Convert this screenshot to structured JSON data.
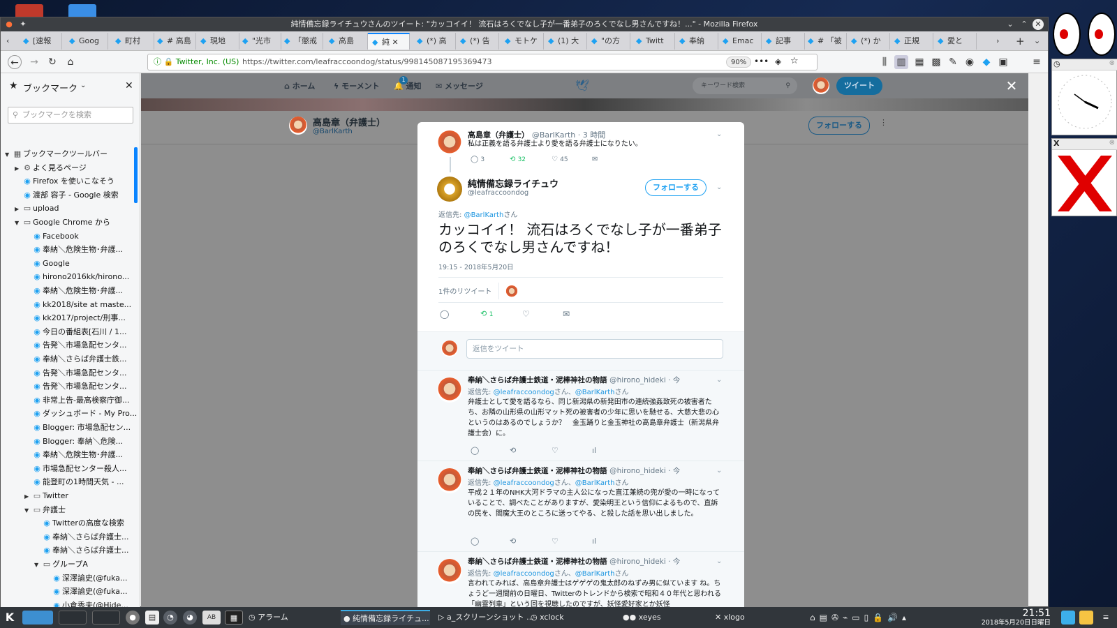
{
  "window": {
    "title": "純情備忘録ライチュウさんのツイート: \"カッコイイ！ 流石はろくでなし子が一番弟子のろくでなし男さんですね！...\" - Mozilla Firefox"
  },
  "tabs": [
    {
      "label": "[速報"
    },
    {
      "label": "Goog"
    },
    {
      "label": "町村"
    },
    {
      "label": "# 高島"
    },
    {
      "label": "現地"
    },
    {
      "label": "\"光市"
    },
    {
      "label": "「懲戒"
    },
    {
      "label": "高島"
    },
    {
      "label": "純"
    },
    {
      "label": "(*) 高"
    },
    {
      "label": "(*) 告"
    },
    {
      "label": "モトケ"
    },
    {
      "label": "(1) 大"
    },
    {
      "label": "\"の方"
    },
    {
      "label": "Twitt"
    },
    {
      "label": "奉納"
    },
    {
      "label": "Emac"
    },
    {
      "label": "記事"
    },
    {
      "label": "# 「被"
    },
    {
      "label": "(*) か"
    },
    {
      "label": "正規"
    },
    {
      "label": "愛と"
    }
  ],
  "urlbar": {
    "site": "Twitter, Inc. (US)",
    "url": "https://twitter.com/leafraccoondog/status/998145087195369473",
    "zoom": "90%"
  },
  "sidebar": {
    "title": "ブックマーク",
    "search_placeholder": "ブックマークを検索",
    "items": [
      {
        "label": "ブックマークツールバー"
      },
      {
        "label": "よく見るページ"
      },
      {
        "label": "Firefox を使いこなそう"
      },
      {
        "label": "渡部 容子 - Google 検索"
      },
      {
        "label": "upload"
      },
      {
        "label": "Google Chrome から"
      },
      {
        "label": "Facebook"
      },
      {
        "label": "奉納＼危険生物･弁護..."
      },
      {
        "label": "Google"
      },
      {
        "label": "hirono2016kk/hirono..."
      },
      {
        "label": "奉納＼危険生物･弁護..."
      },
      {
        "label": "kk2018/site at maste..."
      },
      {
        "label": "kk2017/project/刑事..."
      },
      {
        "label": "今日の番組表[石川 / 1..."
      },
      {
        "label": "告発＼市場急配センタ..."
      },
      {
        "label": "奉納＼さらば弁護士鉄..."
      },
      {
        "label": "告発＼市場急配センタ..."
      },
      {
        "label": "告発＼市場急配センタ..."
      },
      {
        "label": "非常上告-最高検察庁御..."
      },
      {
        "label": "ダッシュボード - My Pro..."
      },
      {
        "label": "Blogger: 市場急配セン..."
      },
      {
        "label": "Blogger: 奉納＼危険..."
      },
      {
        "label": "奉納＼危険生物･弁護..."
      },
      {
        "label": "市場急配センター殺人..."
      },
      {
        "label": "能登町の1時間天気 - ..."
      },
      {
        "label": "Twitter"
      },
      {
        "label": "弁護士"
      },
      {
        "label": "Twitterの高度な検索"
      },
      {
        "label": "奉納＼さらば弁護士..."
      },
      {
        "label": "奉納＼さらば弁護士..."
      },
      {
        "label": "グループA"
      },
      {
        "label": "深澤諭史(@fuka..."
      },
      {
        "label": "深澤諭史(@fuka..."
      },
      {
        "label": "小倉秀夫(@Hide..."
      }
    ]
  },
  "twitter_nav": {
    "home": "ホーム",
    "moments": "モーメント",
    "notifications": "通知",
    "notif_count": "1",
    "messages": "メッセージ",
    "search_placeholder": "キーワード検索",
    "tweet_button": "ツイート"
  },
  "profile_header": {
    "name": "高島章（弁護士）",
    "handle": "@BarlKarth",
    "follow": "フォローする"
  },
  "parent_tweet": {
    "name": "高島章（弁護士）",
    "handle": "@BarlKarth · 3 時間",
    "text": "私は正義を語る弁護士より愛を語る弁護士になりたい。",
    "replies": "3",
    "retweets": "32",
    "likes": "45"
  },
  "main_tweet": {
    "name": "純情備忘録ライチュウ",
    "handle": "@leafraccoondog",
    "follow": "フォローする",
    "reply_to_prefix": "返信先: ",
    "reply_to_user": "@BarlKarth",
    "reply_to_suffix": "さん",
    "text": "カッコイイ！ 流石はろくでなし子が一番弟子のろくでなし男さんですね！",
    "timestamp": "19:15 - 2018年5月20日",
    "retweet_count_label": "1件のリツイート",
    "retweet_count_num": "1",
    "action_retweets": "1"
  },
  "reply_box": {
    "placeholder": "返信をツイート"
  },
  "replies": [
    {
      "name": "奉納＼さらば弁護士鉄道・泥棒神社の物語",
      "handle": "@hirono_hideki · 今",
      "to1": "@leafraccoondog",
      "mid": "さん、",
      "to2": "@BarlKarth",
      "end": "さん",
      "text": "弁護士として愛を語るなら、同じ新潟県の新発田市の連続強姦致死の被害者たち、お隣の山形県の山形マット死の被害者の少年に思いを馳せる、大慈大悲の心というのはあるのでしょうか？　金玉踊りと金玉神社の高島章弁護士（新潟県弁護士会）に。"
    },
    {
      "name": "奉納＼さらば弁護士鉄道・泥棒神社の物語",
      "handle": "@hirono_hideki · 今",
      "to1": "@leafraccoondog",
      "mid": "さん、",
      "to2": "@BarlKarth",
      "end": "さん",
      "text": "平成２１年のNHK大河ドラマの主人公になった直江兼続の兜が愛の一時になっていることで、調べたことがありますが、愛染明王という信仰によるもので、直訴の民を、閻魔大王のところに送ってやる、と殺した話を思い出しました。"
    },
    {
      "name": "奉納＼さらば弁護士鉄道・泥棒神社の物語",
      "handle": "@hirono_hideki · 今",
      "to1": "@leafraccoondog",
      "mid": "さん、",
      "to2": "@BarlKarth",
      "end": "さん",
      "text": "言われてみれば、高島章弁護士はゲゲゲの鬼太郎のねずみ男に似ています ね。ちょうど一週間前の日曜日、Twitterのトレンドから検索で昭和４０年代と思われる「幽霊列車」という回を視聴したのですが、妖怪愛好家とか妖怪"
    }
  ],
  "taskbar": {
    "alarm": "アラーム",
    "firefox": "純情備忘録ライチュ...",
    "screenshot": "a_スクリーンショット ...",
    "xclock": "xclock",
    "xeyes": "xeyes",
    "xlogo": "xlogo",
    "time": "21:51",
    "date": "2018年5月20日日曜日"
  },
  "colors": {
    "twitter_blue": "#1da1f2",
    "taskbar": "#31363b",
    "firefox_accent": "#0a84ff"
  }
}
